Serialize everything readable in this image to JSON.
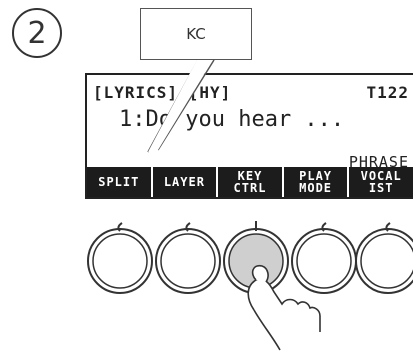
{
  "step_number": "2",
  "callout": {
    "text": "KC"
  },
  "display": {
    "header_left": "[LYRICS] [HY]",
    "header_right": "T122",
    "lyric_line": "1:Do you hear ...",
    "mode_label": "PHRASE"
  },
  "softkeys": [
    {
      "label": "SPLIT"
    },
    {
      "label": "LAYER"
    },
    {
      "label": "KEY\nCTRL"
    },
    {
      "label": "PLAY\nMODE"
    },
    {
      "label": "VOCAL\nIST"
    }
  ],
  "knobs": [
    {
      "name": "split",
      "pressed": false
    },
    {
      "name": "layer",
      "pressed": false
    },
    {
      "name": "key-ctrl",
      "pressed": true
    },
    {
      "name": "play-mode",
      "pressed": false
    },
    {
      "name": "vocalist",
      "pressed": false
    }
  ],
  "colors": {
    "lcd_bar": "#1c1c1c",
    "pressed_knob": "#cfcfcf",
    "outline": "#333333"
  }
}
